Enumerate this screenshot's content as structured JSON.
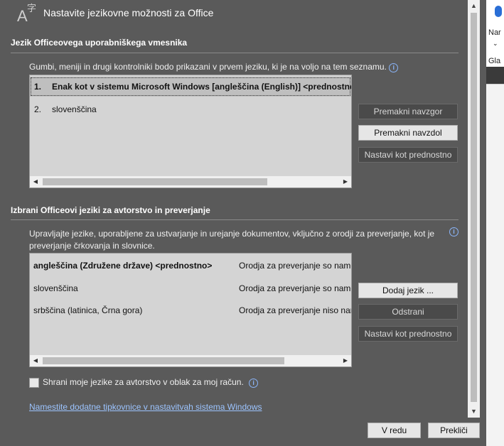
{
  "dialog": {
    "title": "Nastavite jezikovne možnosti za Office"
  },
  "display_section": {
    "title": "Jezik Officeovega uporabniškega vmesnika",
    "description": "Gumbi, meniji in drugi kontrolniki bodo prikazani v prvem jeziku, ki je na voljo na tem seznamu.",
    "items": [
      {
        "num": "1.",
        "label": "Enak kot v sistemu Microsoft Windows [angleščina (English)] <prednostno>"
      },
      {
        "num": "2.",
        "label": "slovenščina"
      }
    ],
    "buttons": {
      "move_up": "Premakni navzgor",
      "move_down": "Premakni navzdol",
      "set_preferred": "Nastavi kot prednostno"
    }
  },
  "authoring_section": {
    "title": "Izbrani Officeovi jeziki za avtorstvo in preverjanje",
    "description": "Upravljajte jezike, uporabljene za ustvarjanje in urejanje dokumentov, vključno z orodji za preverjanje, kot je preverjanje črkovanja in slovnice.",
    "items": [
      {
        "language": "angleščina (Združene države) <prednostno>",
        "status": "Orodja za preverjanje so name"
      },
      {
        "language": "slovenščina",
        "status": "Orodja za preverjanje so name"
      },
      {
        "language": "srbščina (latinica, Črna gora)",
        "status": "Orodja za preverjanje niso nan"
      }
    ],
    "buttons": {
      "add_language": "Dodaj jezik ...",
      "remove": "Odstrani",
      "set_preferred": "Nastavi kot prednostno"
    }
  },
  "cloud_checkbox": {
    "label": "Shrani moje jezike za avtorstvo v oblak za moj račun.",
    "checked": false
  },
  "keyboard_link": "Namestite dodatne tipkovnice v nastavitvah sistema Windows",
  "footer": {
    "ok": "V redu",
    "cancel": "Prekliči"
  },
  "background_app": {
    "ribbon_label_1": "Nar",
    "ribbon_label_2": "Gla"
  },
  "icons": [
    "language-icon",
    "info-icon",
    "scroll-arrow-icon",
    "microphone-icon"
  ],
  "colors": {
    "dialog_bg": "#5a5a5a",
    "list_bg": "#d4d4d4",
    "link": "#9cc4ff",
    "info": "#8ab4f8"
  }
}
